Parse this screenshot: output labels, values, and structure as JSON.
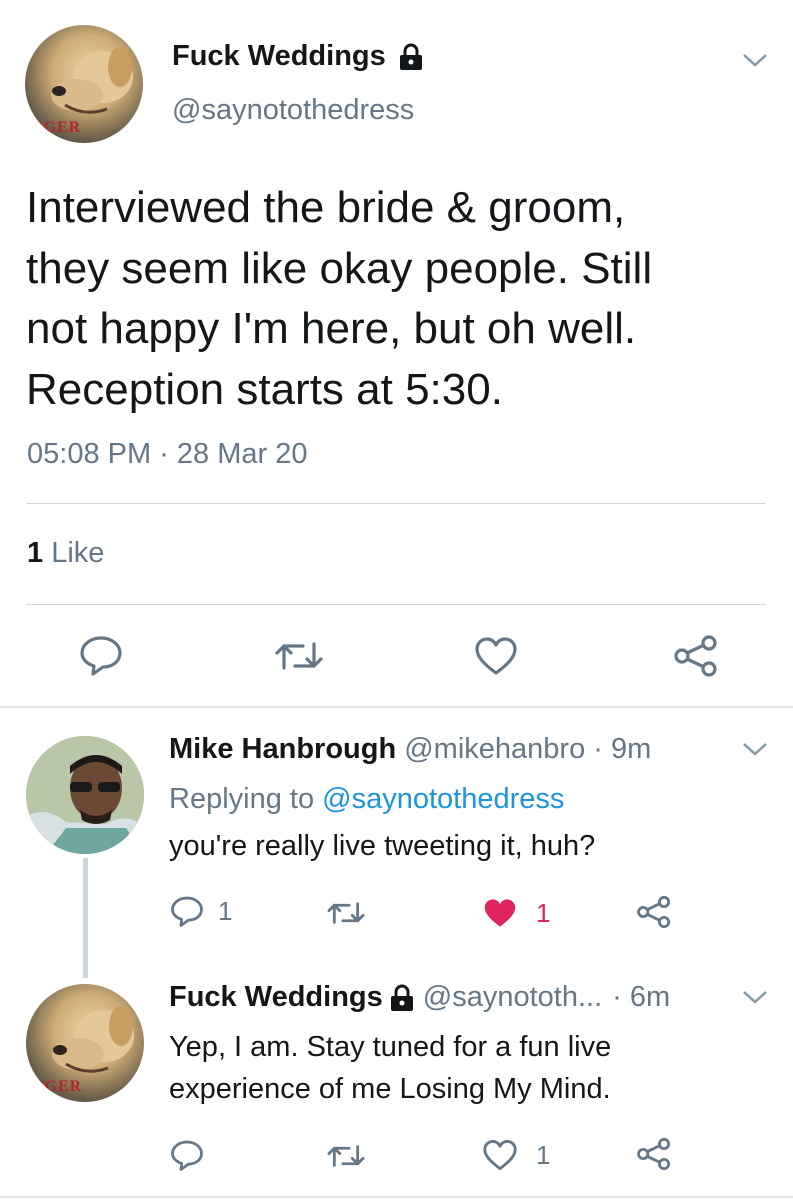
{
  "main_tweet": {
    "display_name": "Fuck Weddings",
    "handle": "@saynotothedress",
    "avatar_text": "NGER",
    "text_lines": [
      "Interviewed the bride & groom,",
      "they seem like okay people. Still",
      "not happy I'm here, but oh well.",
      "Reception starts at 5:30."
    ],
    "timestamp": "05:08 PM · 28 Mar 20",
    "likes_count": "1",
    "likes_label": "Like"
  },
  "reply_1": {
    "display_name": "Mike Hanbrough",
    "handle": "@mikehanbro",
    "time": "· 9m",
    "replying_prefix": "Replying to",
    "replying_handle": "@saynotothedress",
    "text": "you're really live tweeting it, huh?",
    "reply_count": "1",
    "like_count": "1"
  },
  "reply_2": {
    "display_name": "Fuck Weddings",
    "handle": "@saynototh...",
    "time": "· 6m",
    "avatar_text": "NGER",
    "text_lines": [
      "Yep, I am. Stay tuned for a fun live",
      "experience of me Losing My Mind."
    ],
    "like_count": "1"
  },
  "colors": {
    "accent": "#1b95e0",
    "muted": "#657786",
    "heart_liked": "#e0245e",
    "divider": "#ccd6dd"
  },
  "icons": [
    "lock-icon",
    "chevron-down-icon",
    "reply-icon",
    "retweet-icon",
    "heart-icon",
    "share-icon"
  ]
}
